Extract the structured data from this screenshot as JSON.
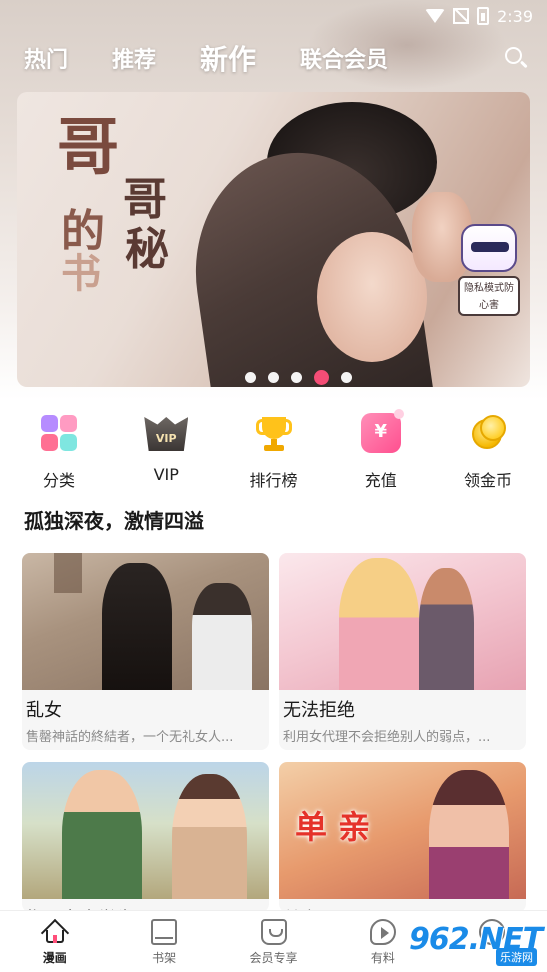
{
  "status_bar": {
    "time": "2:39"
  },
  "top_tabs": [
    "热门",
    "推荐",
    "新作",
    "联合会员"
  ],
  "active_top_tab": "新作",
  "banner": {
    "title_line1": "哥",
    "title_line2": "哥",
    "title_line3": "的",
    "title_line4": "秘",
    "title_line5": "书",
    "badge_text": "隐私模式防心害",
    "carousel_count": 5,
    "carousel_active_index": 3
  },
  "quick_menu": [
    {
      "label": "分类",
      "icon": "category-grid-icon"
    },
    {
      "label": "VIP",
      "icon": "vip-crown-icon"
    },
    {
      "label": "排行榜",
      "icon": "trophy-icon"
    },
    {
      "label": "充值",
      "icon": "recharge-icon"
    },
    {
      "label": "领金币",
      "icon": "gold-coin-icon"
    }
  ],
  "section": {
    "title": "孤独深夜，激情四溢"
  },
  "comics": [
    {
      "name": "乱女",
      "desc": "售罄神話的終結者，一个无礼女人..."
    },
    {
      "name": "无法拒绝",
      "desc": "利用女代理不会拒绝别人的弱点，..."
    },
    {
      "name": "指导女大学生",
      "desc": ""
    },
    {
      "name": "单亲",
      "desc": "",
      "cover_text": "单 亲"
    }
  ],
  "bottom_nav": [
    {
      "label": "漫画",
      "icon": "home-icon"
    },
    {
      "label": "书架",
      "icon": "bookshelf-icon"
    },
    {
      "label": "会员专享",
      "icon": "member-icon"
    },
    {
      "label": "有料",
      "icon": "play-icon"
    },
    {
      "label": "",
      "icon": "profile-icon"
    }
  ],
  "watermark": {
    "main": "962.NET",
    "sub": "乐游网"
  },
  "colors": {
    "accent": "#ff4f7a",
    "watermark": "#1a8be8"
  }
}
